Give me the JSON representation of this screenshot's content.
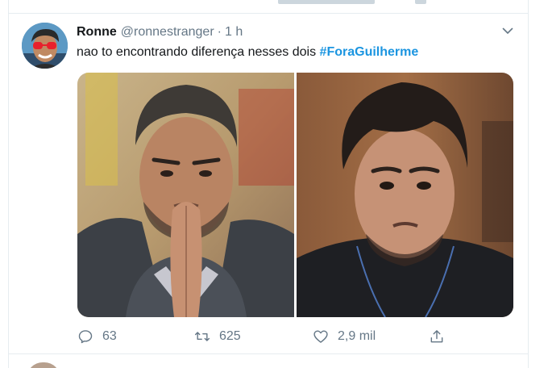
{
  "tweet": {
    "author": {
      "display_name": "Ronne",
      "handle": "@ronnestranger",
      "separator": "·",
      "time": "1 h",
      "avatar_icon": "avatar-photo"
    },
    "text": "nao to encontrando diferença nesses dois",
    "hashtag": "#ForaGuilherme",
    "menu_icon": "chevron-down-icon",
    "media": [
      {
        "icon": "photo-man-praying-hands"
      },
      {
        "icon": "photo-man-dark-hair"
      }
    ],
    "actions": {
      "reply_count": "63",
      "retweet_count": "625",
      "like_count": "2,9 mil"
    }
  },
  "colors": {
    "accent": "#1b95e0",
    "muted": "#657786",
    "divider": "#e6ecf0",
    "text": "#14171a"
  }
}
